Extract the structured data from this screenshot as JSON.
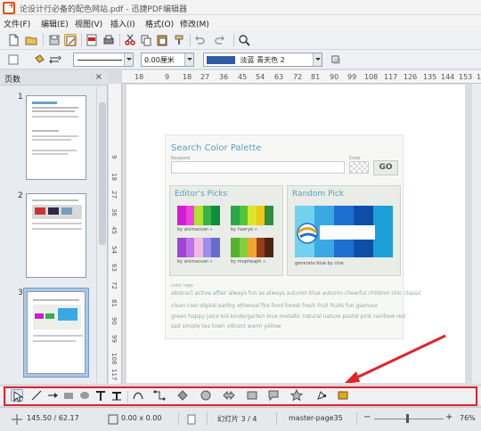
{
  "window": {
    "title": "论设计行必备的配色网站.pdf - 迅捷PDF编辑器"
  },
  "menu": [
    "文件(F)",
    "编辑(E)",
    "视图(V)",
    "插入(I)",
    "格式(O)",
    "修改(M)"
  ],
  "format_toolbar": {
    "line_width": "0.00厘米",
    "area_fill": "淡蓝 青天色 2",
    "area_fill_color": "#2f5aa8"
  },
  "slides_panel": {
    "title": "页数",
    "close": "×",
    "thumbnails": [
      {
        "number": "1"
      },
      {
        "number": "2"
      },
      {
        "number": "3",
        "selected": true
      }
    ]
  },
  "ruler": {
    "h_ticks": [
      "18",
      "9",
      "18",
      "27",
      "36",
      "45",
      "54",
      "63",
      "72",
      "81",
      "90",
      "99",
      "108",
      "117",
      "126",
      "135",
      "144",
      "153",
      "162"
    ],
    "v_ticks": [
      "9",
      "18",
      "27",
      "36",
      "45",
      "54",
      "63",
      "72",
      "81",
      "90",
      "99",
      "108",
      "117"
    ]
  },
  "slide": {
    "search_header": "Search Color Palette",
    "keyword_label": "Keyword",
    "color_label": "Color",
    "go_button": "GO",
    "editors_picks": {
      "title": "Editor's Picks",
      "palettes": [
        {
          "caption": "by animasvan »",
          "colors": [
            "#d01fd0",
            "#f23fe0",
            "#b1e030",
            "#39b14a",
            "#0c8e3a"
          ]
        },
        {
          "caption": "by haeryo »",
          "colors": [
            "#2da64b",
            "#52c43c",
            "#dbe629",
            "#f0c617",
            "#2f8f3f"
          ]
        },
        {
          "caption": "by animasvan »",
          "colors": [
            "#a045d6",
            "#c071ee",
            "#f0b8e5",
            "#9c8fe8",
            "#6a6bd0"
          ]
        },
        {
          "caption": "by mopheaph »",
          "colors": [
            "#55b02f",
            "#7fd03c",
            "#f0a531",
            "#9a3c1c",
            "#4a2612"
          ]
        }
      ]
    },
    "random_pick": {
      "title": "Random Pick",
      "caption": "generate blue by cine",
      "colors": [
        "#6fd2ee",
        "#3aa9e1",
        "#1f6fd0",
        "#0d4fa8",
        "#1c9fd8"
      ]
    },
    "tags_label": "color tags",
    "tag_lines": [
      "abstract active affair always fun as always autumn blue autumn cheerful children chic classic",
      "clean cool digital earthy ethereal fire food forest fresh fruit fruits fun glamour",
      "green happy juice kid kindergarten love metallic natural nature pastel pink rainbow red",
      "sad simple tea town vibrant warm yellow"
    ]
  },
  "status": {
    "position": "145.50 / 62.17",
    "size": "0.00 x 0.00",
    "slide": "幻灯片 3 / 4",
    "master": "master-page35",
    "zoom": "76%"
  },
  "colors": {
    "highlight": "#e3222a",
    "accent": "#58a0b8"
  }
}
